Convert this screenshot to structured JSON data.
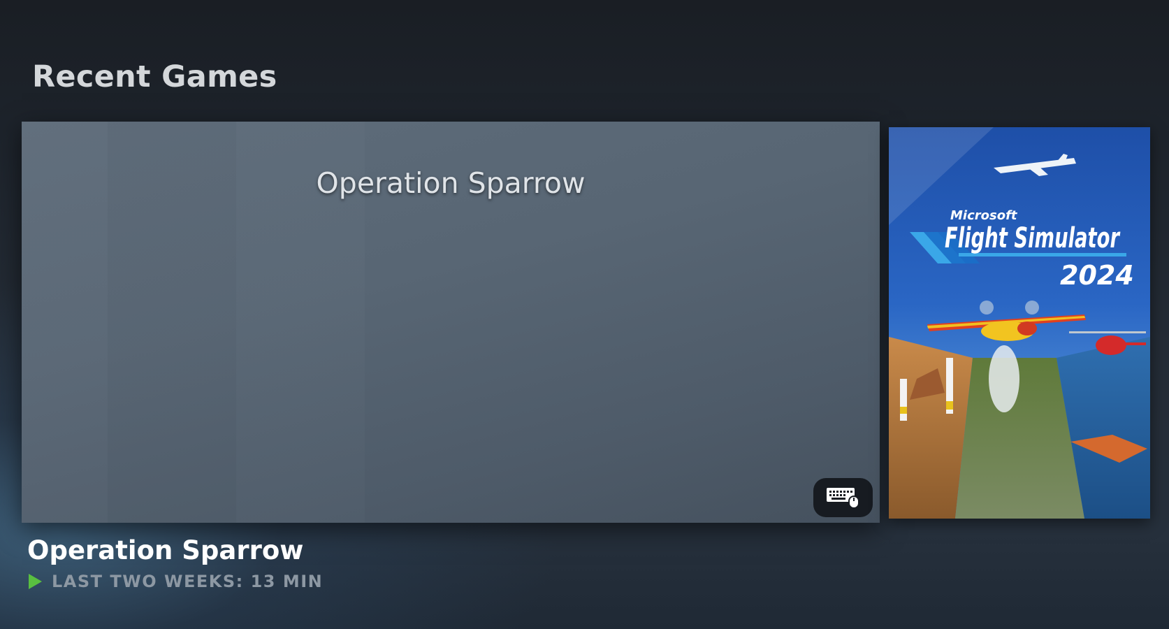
{
  "section": {
    "title": "Recent Games"
  },
  "hero": {
    "game_title": "Operation Sparrow",
    "input_icon": "keyboard-mouse-icon"
  },
  "side_game": {
    "publisher": "Microsoft",
    "title": "Flight Simulator",
    "year": "2024"
  },
  "selected": {
    "name": "Operation Sparrow",
    "playtime": "LAST TWO WEEKS: 13 MIN",
    "play_icon": "play-icon"
  },
  "colors": {
    "accent_green": "#59bf40",
    "title_text": "#d4d7da",
    "muted_text": "#8d98a3"
  }
}
